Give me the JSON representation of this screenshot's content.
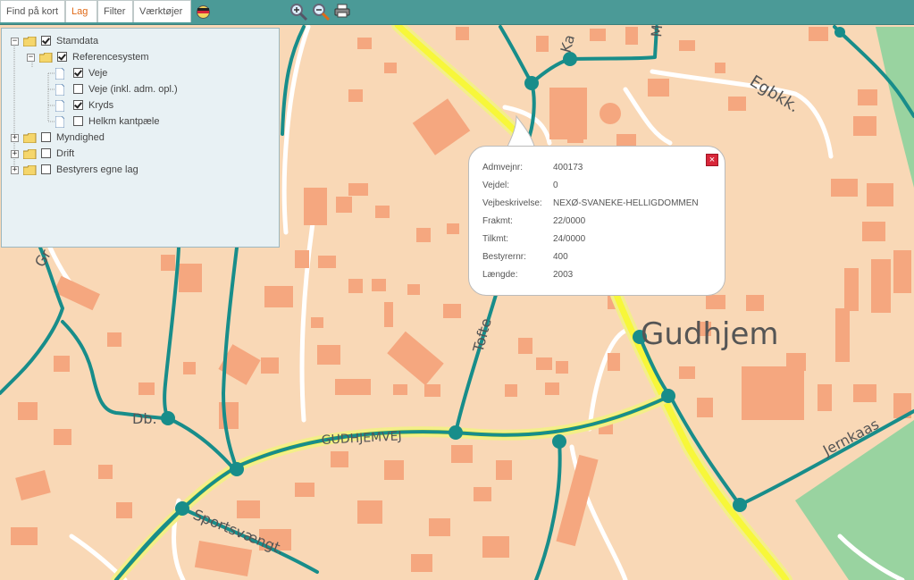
{
  "toolbar": {
    "tabs": [
      {
        "label": "Find på kort"
      },
      {
        "label": "Lag"
      },
      {
        "label": "Filter"
      },
      {
        "label": "Værktøjer"
      }
    ],
    "active_tab": "Lag"
  },
  "layers": {
    "items": [
      {
        "label": "Stamdata",
        "checked": true,
        "expanded": true
      },
      {
        "label": "Referencesystem",
        "checked": true,
        "expanded": true
      },
      {
        "label": "Veje",
        "checked": true
      },
      {
        "label": "Veje (inkl. adm. opl.)",
        "checked": false
      },
      {
        "label": "Kryds",
        "checked": true
      },
      {
        "label": "Helkm kantpæle",
        "checked": false
      },
      {
        "label": "Myndighed",
        "checked": false,
        "expanded": false
      },
      {
        "label": "Drift",
        "checked": false,
        "expanded": false
      },
      {
        "label": "Bestyrers egne lag",
        "checked": false,
        "expanded": false
      }
    ]
  },
  "popup": {
    "rows": [
      {
        "key": "Admvejnr:",
        "value": "400173"
      },
      {
        "key": "Vejdel:",
        "value": "0"
      },
      {
        "key": "Vejbeskrivelse:",
        "value": "NEXØ-SVANEKE-HELLIGDOMMEN"
      },
      {
        "key": "Frakmt:",
        "value": "22/0000"
      },
      {
        "key": "Tilkmt:",
        "value": "24/0000"
      },
      {
        "key": "Bestyrernr:",
        "value": "400"
      },
      {
        "key": "Længde:",
        "value": "2003"
      }
    ],
    "close_icon": "close-icon"
  },
  "map": {
    "labels": {
      "town": "Gudhjem",
      "road_main": "GUDHJEMVEJ",
      "egbkk": "Egbkk.",
      "jernkaas": "Jernkaas",
      "toft": "Tofte",
      "dbl": "Db.",
      "sports": "Sportsvængt.",
      "ka": "Ka",
      "ma": "Ma",
      "gr": "Gr"
    },
    "colors": {
      "background": "#f9d8b6",
      "buildings": "#f5a77f",
      "roads_network": "#188d8a",
      "main_road": "#f7f73a",
      "green": "#99d3a0"
    }
  }
}
